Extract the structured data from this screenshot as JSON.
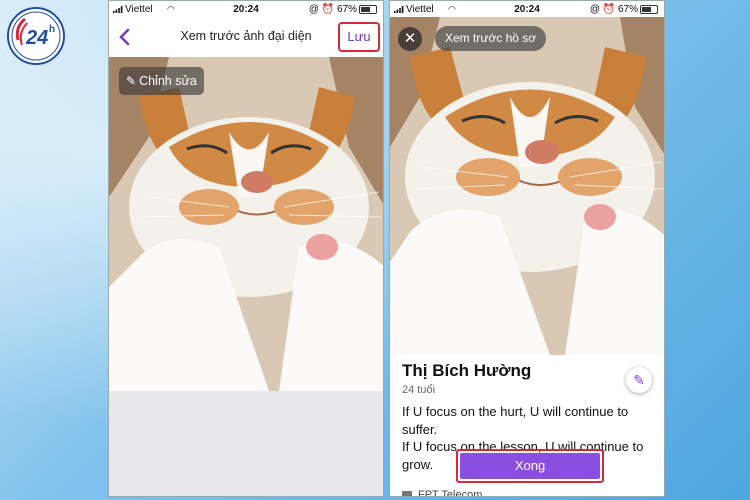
{
  "logo": {
    "text": "24h",
    "registered": "®",
    "color": "#1f4f9e"
  },
  "phone1": {
    "status": {
      "carrier": "Viettel",
      "time": "20:24",
      "battery": "67%"
    },
    "nav": {
      "title": "Xem trước ảnh đại diện",
      "save_label": "Lưu"
    },
    "edit_label": "Chỉnh sửa"
  },
  "phone2": {
    "status": {
      "carrier": "Viettel",
      "time": "20:24",
      "battery": "67%"
    },
    "preview_label": "Xem trước hồ sơ",
    "profile": {
      "name": "Thị Bích Hường",
      "age": "24 tuổi",
      "bio_line1": "If U focus on the hurt, U will continue to suffer.",
      "bio_line2": "If U focus on the lesson, U will continue to grow."
    },
    "done_label": "Xong",
    "isp": "FPT Telecom"
  },
  "colors": {
    "accent": "#8a4fe0",
    "highlight": "#d8263a",
    "link": "#6f38c7"
  },
  "icons": [
    "back-chevron-icon",
    "magic-wand-icon",
    "close-icon",
    "pencil-icon",
    "wifi-icon",
    "battery-icon"
  ]
}
